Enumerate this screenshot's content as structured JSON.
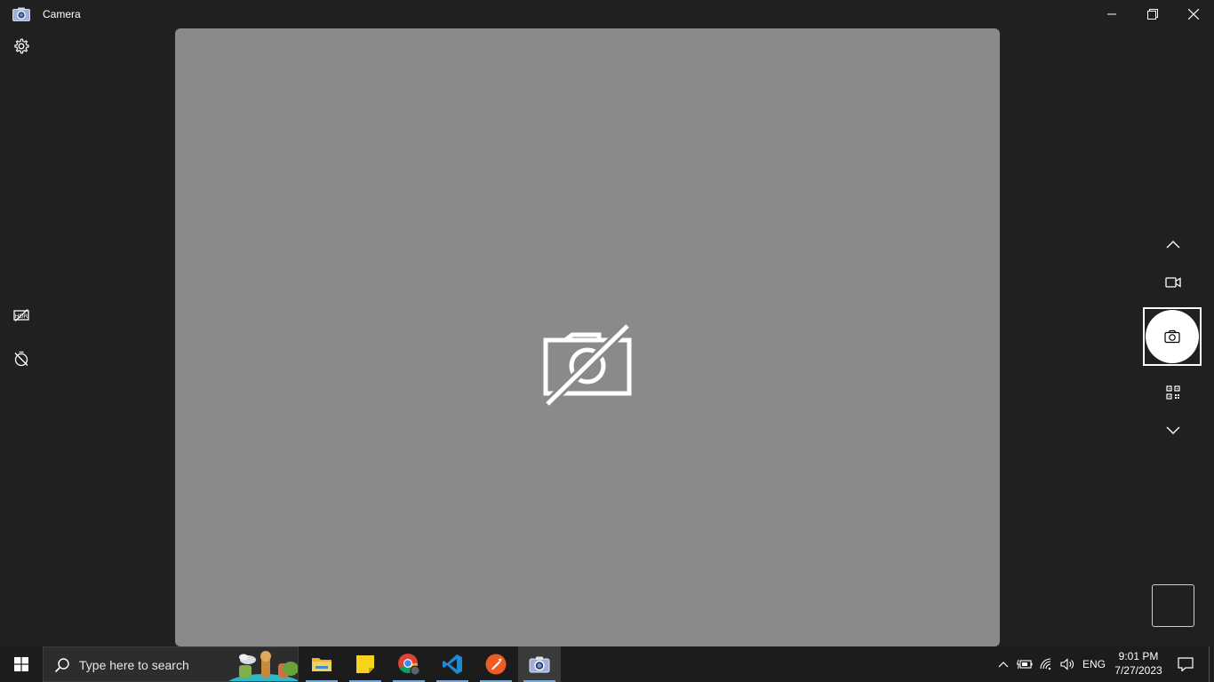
{
  "window": {
    "title": "Camera",
    "controls": [
      "minimize",
      "restore",
      "close"
    ]
  },
  "left_toolbar": {
    "items": [
      {
        "name": "settings",
        "icon": "gear-icon"
      },
      {
        "name": "hdr",
        "icon": "hdr-icon"
      },
      {
        "name": "timer",
        "icon": "timer-off-icon"
      }
    ]
  },
  "viewfinder": {
    "status_icon": "camera-off-icon",
    "background": "#8a8a8c"
  },
  "right_toolbar": {
    "items": [
      {
        "name": "scroll-up",
        "icon": "chevron-up-icon"
      },
      {
        "name": "video-mode",
        "icon": "video-camera-icon"
      },
      {
        "name": "take-photo",
        "icon": "camera-icon"
      },
      {
        "name": "barcode-mode",
        "icon": "qr-code-icon"
      },
      {
        "name": "scroll-down",
        "icon": "chevron-down-icon"
      }
    ]
  },
  "taskbar": {
    "search": {
      "placeholder": "Type here to search"
    },
    "apps": [
      {
        "name": "File Explorer",
        "icon": "folder-icon"
      },
      {
        "name": "Sticky Notes",
        "icon": "sticky-notes-icon"
      },
      {
        "name": "Google Chrome",
        "icon": "chrome-icon"
      },
      {
        "name": "Visual Studio Code",
        "icon": "vscode-icon"
      },
      {
        "name": "Postman",
        "icon": "postman-icon"
      },
      {
        "name": "Camera",
        "icon": "camera-app-icon"
      }
    ],
    "tray": {
      "language": "ENG",
      "time": "9:01 PM",
      "date": "7/27/2023"
    }
  },
  "colors": {
    "window_bg": "#202020",
    "taskbar_bg": "#1c1c1c",
    "accent": "#7aa7d6"
  }
}
